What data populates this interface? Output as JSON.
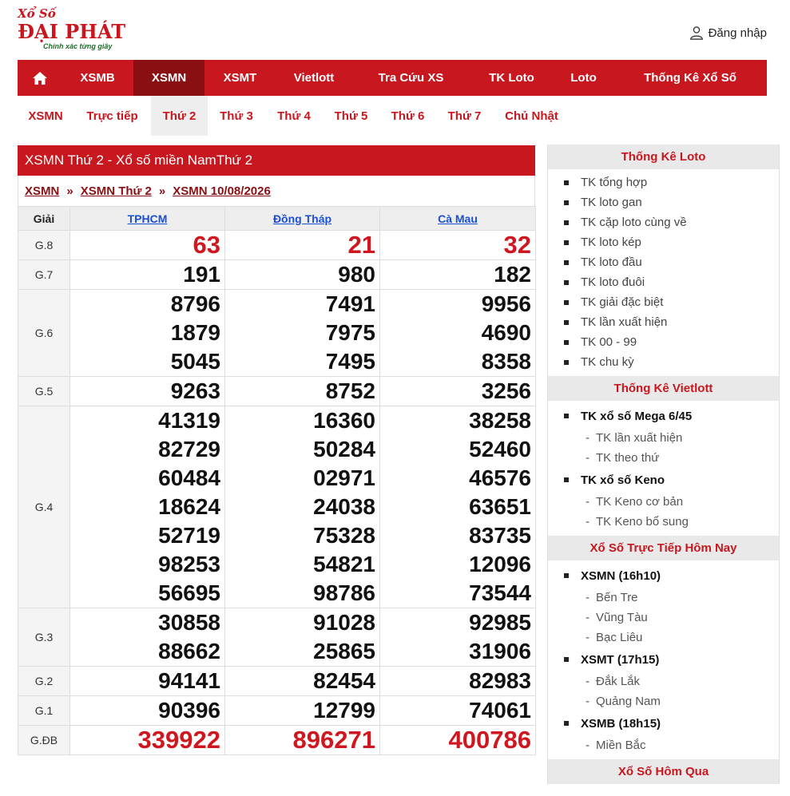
{
  "logo": {
    "top": "Xổ Số",
    "main": "ĐẠI PHÁT",
    "tagline": "Chính xác từng giây"
  },
  "header": {
    "login_label": "Đăng nhập"
  },
  "mainnav": {
    "items": [
      "XSMB",
      "XSMN",
      "XSMT",
      "Vietlott",
      "Tra Cứu XS",
      "TK Loto",
      "Loto",
      "Thống Kê Xổ Số"
    ],
    "active": "XSMN"
  },
  "subnav": {
    "items": [
      "XSMN",
      "Trực tiếp",
      "Thứ 2",
      "Thứ 3",
      "Thứ 4",
      "Thứ 5",
      "Thứ 6",
      "Thứ 7",
      "Chủ Nhật"
    ],
    "active": "Thứ 2"
  },
  "results": {
    "title": "XSMN Thứ 2 - Xổ số miền NamThứ 2",
    "breadcrumb": [
      "XSMN",
      "XSMN Thứ 2",
      "XSMN 10/08/2026"
    ],
    "breadcrumb_sep": "»",
    "col_giai": "Giải",
    "provinces": [
      "TPHCM",
      "Đồng Tháp",
      "Cà Mau"
    ],
    "prizes": [
      {
        "name": "G.8",
        "red": true,
        "values": [
          [
            "63"
          ],
          [
            "21"
          ],
          [
            "32"
          ]
        ]
      },
      {
        "name": "G.7",
        "red": false,
        "values": [
          [
            "191"
          ],
          [
            "980"
          ],
          [
            "182"
          ]
        ]
      },
      {
        "name": "G.6",
        "red": false,
        "values": [
          [
            "8796",
            "1879",
            "5045"
          ],
          [
            "7491",
            "7975",
            "7495"
          ],
          [
            "9956",
            "4690",
            "8358"
          ]
        ]
      },
      {
        "name": "G.5",
        "red": false,
        "values": [
          [
            "9263"
          ],
          [
            "8752"
          ],
          [
            "3256"
          ]
        ]
      },
      {
        "name": "G.4",
        "red": false,
        "values": [
          [
            "41319",
            "82729",
            "60484",
            "18624",
            "52719",
            "98253",
            "56695"
          ],
          [
            "16360",
            "50284",
            "02971",
            "24038",
            "75328",
            "54821",
            "98786"
          ],
          [
            "38258",
            "52460",
            "46576",
            "63651",
            "83735",
            "12096",
            "73544"
          ]
        ]
      },
      {
        "name": "G.3",
        "red": false,
        "values": [
          [
            "30858",
            "88662"
          ],
          [
            "91028",
            "25865"
          ],
          [
            "92985",
            "31906"
          ]
        ]
      },
      {
        "name": "G.2",
        "red": false,
        "values": [
          [
            "94141"
          ],
          [
            "82454"
          ],
          [
            "82983"
          ]
        ]
      },
      {
        "name": "G.1",
        "red": false,
        "values": [
          [
            "90396"
          ],
          [
            "12799"
          ],
          [
            "74061"
          ]
        ]
      },
      {
        "name": "G.ĐB",
        "red": true,
        "values": [
          [
            "339922"
          ],
          [
            "896271"
          ],
          [
            "400786"
          ]
        ]
      }
    ]
  },
  "sidebar": {
    "sections": [
      {
        "title": "Thống Kê Loto",
        "items": [
          {
            "label": "TK tổng hợp",
            "level": 1
          },
          {
            "label": "TK loto gan",
            "level": 1
          },
          {
            "label": "TK cặp loto cùng về",
            "level": 1
          },
          {
            "label": "TK loto kép",
            "level": 1
          },
          {
            "label": "TK loto đầu",
            "level": 1
          },
          {
            "label": "TK loto đuôi",
            "level": 1
          },
          {
            "label": "TK giải đặc biệt",
            "level": 1
          },
          {
            "label": "TK lần xuất hiện",
            "level": 1
          },
          {
            "label": "TK 00 - 99",
            "level": 1
          },
          {
            "label": "TK chu kỳ",
            "level": 1
          }
        ]
      },
      {
        "title": "Thống Kê Vietlott",
        "items": [
          {
            "label": "TK xổ số Mega 6/45",
            "level": 1,
            "strong": true
          },
          {
            "label": "TK lần xuất hiện",
            "level": 2
          },
          {
            "label": "TK theo thứ",
            "level": 2
          },
          {
            "label": "TK xổ số Keno",
            "level": 1,
            "strong": true
          },
          {
            "label": "TK Keno cơ bản",
            "level": 2
          },
          {
            "label": "TK Keno bổ sung",
            "level": 2
          }
        ]
      },
      {
        "title": "Xổ Số Trực Tiếp Hôm Nay",
        "items": [
          {
            "label": "XSMN (16h10)",
            "level": 1,
            "strong": true
          },
          {
            "label": "Bến Tre",
            "level": 2
          },
          {
            "label": "Vũng Tàu",
            "level": 2
          },
          {
            "label": "Bạc Liêu",
            "level": 2
          },
          {
            "label": "XSMT (17h15)",
            "level": 1,
            "strong": true
          },
          {
            "label": "Đắk Lắk",
            "level": 2
          },
          {
            "label": "Quảng Nam",
            "level": 2
          },
          {
            "label": "XSMB (18h15)",
            "level": 1,
            "strong": true
          },
          {
            "label": "Miền Bắc",
            "level": 2
          }
        ]
      },
      {
        "title": "Xổ Số Hôm Qua",
        "items": []
      }
    ]
  },
  "colors": {
    "brand_red": "#c8171e",
    "active_dark_red": "#8a0f13",
    "link_blue": "#1a4fd6"
  },
  "icons": {
    "home": "home-icon",
    "user": "user-icon"
  }
}
